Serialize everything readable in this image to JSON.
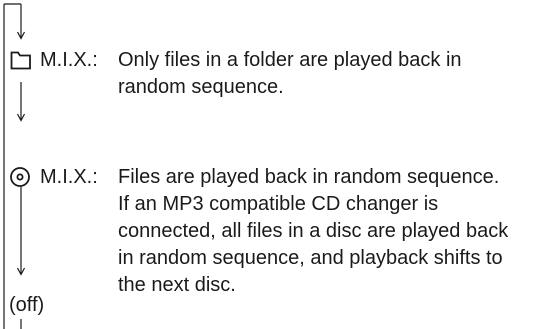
{
  "modes": [
    {
      "icon": "folder-icon",
      "label": "M.I.X.:",
      "lines": [
        "Only files in a folder are played back in",
        "random sequence."
      ]
    },
    {
      "icon": "disc-icon",
      "label": "M.I.X.:",
      "lines": [
        "Files are played back in random sequence.",
        "If an MP3 compatible CD changer is",
        "connected, all files in a disc are played back",
        "in random sequence, and playback shifts to",
        "the next disc."
      ]
    }
  ],
  "off_label": "(off)"
}
